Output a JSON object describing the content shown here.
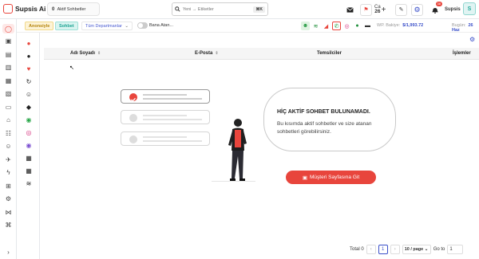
{
  "brand": {
    "name": "Supsis Ai"
  },
  "topbar": {
    "active_count": "0",
    "active_label": "Aktif Sohbetler",
    "search_placeholder": "Yeni → Etiketler",
    "search_shortcut": "⌘K",
    "ca_label": "Ca",
    "ca_count": "26",
    "notification_badge": "38",
    "user_name": "Supsis",
    "avatar_initial": "S"
  },
  "filters": {
    "unassigned": "Anonsiyle",
    "chat": "Sohbet",
    "department": "Tüm Departmanlar",
    "assigned_to_me": "Bana Atan...",
    "wp_balance_label": "WP. Bakiye:",
    "wp_balance_value": "$/1,993.72",
    "today_label": "Bugün:",
    "today_value": "26 Haz"
  },
  "table": {
    "col_name": "Adı Soyadı",
    "col_email": "E-Posta",
    "col_reps": "Temsilciler",
    "col_actions": "İşlemler"
  },
  "empty_state": {
    "title": "HİÇ AKTİF SOHBET BULUNAMADI.",
    "description": "Bu kısımda aktif sohbetler ve size atanan sohbetleri görebilirsiniz.",
    "cta_label": "Müşteri Sayfasına Git"
  },
  "pagination": {
    "total_label": "Total 0",
    "current_page": "1",
    "page_size": "10 / page",
    "goto_label": "Go to",
    "goto_value": "1"
  },
  "colors": {
    "accent": "#e8453c",
    "link_blue": "#3a4fc9"
  }
}
